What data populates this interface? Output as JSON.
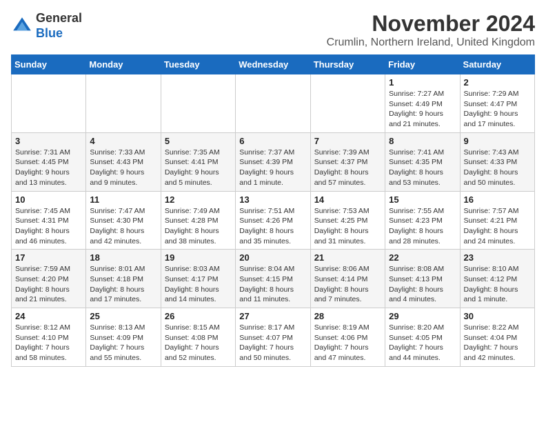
{
  "logo": {
    "general": "General",
    "blue": "Blue"
  },
  "header": {
    "month_title": "November 2024",
    "location": "Crumlin, Northern Ireland, United Kingdom"
  },
  "weekdays": [
    "Sunday",
    "Monday",
    "Tuesday",
    "Wednesday",
    "Thursday",
    "Friday",
    "Saturday"
  ],
  "weeks": [
    [
      {
        "day": "",
        "info": ""
      },
      {
        "day": "",
        "info": ""
      },
      {
        "day": "",
        "info": ""
      },
      {
        "day": "",
        "info": ""
      },
      {
        "day": "",
        "info": ""
      },
      {
        "day": "1",
        "info": "Sunrise: 7:27 AM\nSunset: 4:49 PM\nDaylight: 9 hours\nand 21 minutes."
      },
      {
        "day": "2",
        "info": "Sunrise: 7:29 AM\nSunset: 4:47 PM\nDaylight: 9 hours\nand 17 minutes."
      }
    ],
    [
      {
        "day": "3",
        "info": "Sunrise: 7:31 AM\nSunset: 4:45 PM\nDaylight: 9 hours\nand 13 minutes."
      },
      {
        "day": "4",
        "info": "Sunrise: 7:33 AM\nSunset: 4:43 PM\nDaylight: 9 hours\nand 9 minutes."
      },
      {
        "day": "5",
        "info": "Sunrise: 7:35 AM\nSunset: 4:41 PM\nDaylight: 9 hours\nand 5 minutes."
      },
      {
        "day": "6",
        "info": "Sunrise: 7:37 AM\nSunset: 4:39 PM\nDaylight: 9 hours\nand 1 minute."
      },
      {
        "day": "7",
        "info": "Sunrise: 7:39 AM\nSunset: 4:37 PM\nDaylight: 8 hours\nand 57 minutes."
      },
      {
        "day": "8",
        "info": "Sunrise: 7:41 AM\nSunset: 4:35 PM\nDaylight: 8 hours\nand 53 minutes."
      },
      {
        "day": "9",
        "info": "Sunrise: 7:43 AM\nSunset: 4:33 PM\nDaylight: 8 hours\nand 50 minutes."
      }
    ],
    [
      {
        "day": "10",
        "info": "Sunrise: 7:45 AM\nSunset: 4:31 PM\nDaylight: 8 hours\nand 46 minutes."
      },
      {
        "day": "11",
        "info": "Sunrise: 7:47 AM\nSunset: 4:30 PM\nDaylight: 8 hours\nand 42 minutes."
      },
      {
        "day": "12",
        "info": "Sunrise: 7:49 AM\nSunset: 4:28 PM\nDaylight: 8 hours\nand 38 minutes."
      },
      {
        "day": "13",
        "info": "Sunrise: 7:51 AM\nSunset: 4:26 PM\nDaylight: 8 hours\nand 35 minutes."
      },
      {
        "day": "14",
        "info": "Sunrise: 7:53 AM\nSunset: 4:25 PM\nDaylight: 8 hours\nand 31 minutes."
      },
      {
        "day": "15",
        "info": "Sunrise: 7:55 AM\nSunset: 4:23 PM\nDaylight: 8 hours\nand 28 minutes."
      },
      {
        "day": "16",
        "info": "Sunrise: 7:57 AM\nSunset: 4:21 PM\nDaylight: 8 hours\nand 24 minutes."
      }
    ],
    [
      {
        "day": "17",
        "info": "Sunrise: 7:59 AM\nSunset: 4:20 PM\nDaylight: 8 hours\nand 21 minutes."
      },
      {
        "day": "18",
        "info": "Sunrise: 8:01 AM\nSunset: 4:18 PM\nDaylight: 8 hours\nand 17 minutes."
      },
      {
        "day": "19",
        "info": "Sunrise: 8:03 AM\nSunset: 4:17 PM\nDaylight: 8 hours\nand 14 minutes."
      },
      {
        "day": "20",
        "info": "Sunrise: 8:04 AM\nSunset: 4:15 PM\nDaylight: 8 hours\nand 11 minutes."
      },
      {
        "day": "21",
        "info": "Sunrise: 8:06 AM\nSunset: 4:14 PM\nDaylight: 8 hours\nand 7 minutes."
      },
      {
        "day": "22",
        "info": "Sunrise: 8:08 AM\nSunset: 4:13 PM\nDaylight: 8 hours\nand 4 minutes."
      },
      {
        "day": "23",
        "info": "Sunrise: 8:10 AM\nSunset: 4:12 PM\nDaylight: 8 hours\nand 1 minute."
      }
    ],
    [
      {
        "day": "24",
        "info": "Sunrise: 8:12 AM\nSunset: 4:10 PM\nDaylight: 7 hours\nand 58 minutes."
      },
      {
        "day": "25",
        "info": "Sunrise: 8:13 AM\nSunset: 4:09 PM\nDaylight: 7 hours\nand 55 minutes."
      },
      {
        "day": "26",
        "info": "Sunrise: 8:15 AM\nSunset: 4:08 PM\nDaylight: 7 hours\nand 52 minutes."
      },
      {
        "day": "27",
        "info": "Sunrise: 8:17 AM\nSunset: 4:07 PM\nDaylight: 7 hours\nand 50 minutes."
      },
      {
        "day": "28",
        "info": "Sunrise: 8:19 AM\nSunset: 4:06 PM\nDaylight: 7 hours\nand 47 minutes."
      },
      {
        "day": "29",
        "info": "Sunrise: 8:20 AM\nSunset: 4:05 PM\nDaylight: 7 hours\nand 44 minutes."
      },
      {
        "day": "30",
        "info": "Sunrise: 8:22 AM\nSunset: 4:04 PM\nDaylight: 7 hours\nand 42 minutes."
      }
    ]
  ]
}
